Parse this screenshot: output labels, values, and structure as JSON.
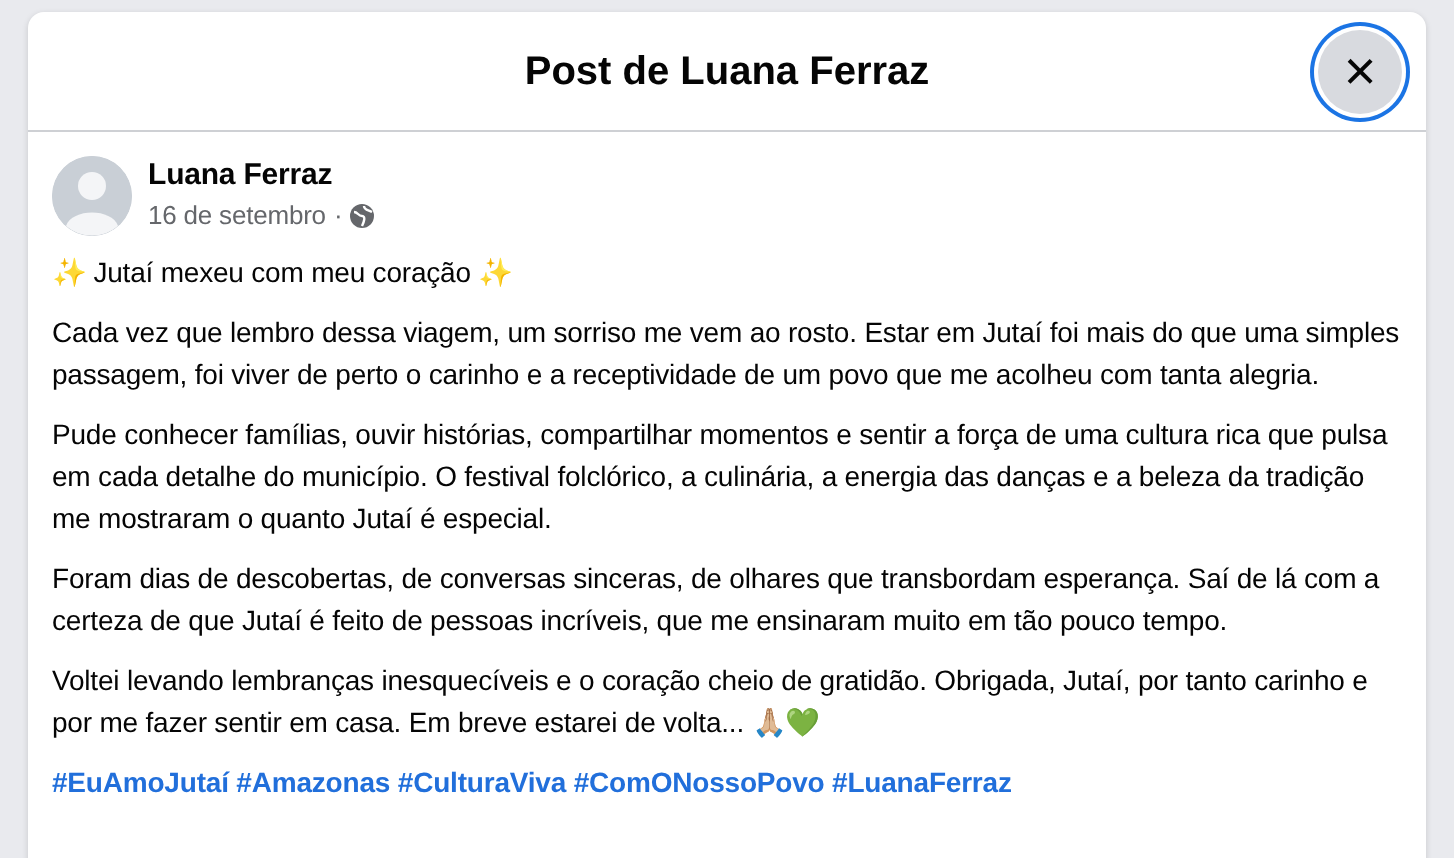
{
  "dialog": {
    "title": "Post de Luana Ferraz",
    "close": {
      "label": "×",
      "focused": true
    }
  },
  "post": {
    "author": "Luana Ferraz",
    "date": "16 de setembro",
    "separator": "·",
    "paragraphs": [
      "✨ Jutaí mexeu com meu coração ✨",
      "Cada vez que lembro dessa viagem, um sorriso me vem ao rosto. Estar em Jutaí foi mais do que uma simples passagem, foi viver de perto o carinho e a receptividade de um povo que me acolheu com tanta alegria.",
      "Pude conhecer famílias, ouvir histórias, compartilhar momentos e sentir a força de uma cultura rica que pulsa em cada detalhe do município. O festival folclórico, a culinária, a energia das danças e a beleza da tradição me mostraram o quanto Jutaí é especial.",
      "Foram dias de descobertas, de conversas sinceras, de olhares que transbordam esperança. Saí de lá com a certeza de que Jutaí é feito de pessoas incríveis, que me ensinaram muito em tão pouco tempo.",
      "Voltei levando lembranças inesquecíveis e o coração cheio de gratidão. Obrigada, Jutaí, por tanto carinho e por me fazer sentir em casa. Em breve estarei de volta... 🙏🏼💚"
    ],
    "hashtags": [
      "#EuAmoJutaí",
      "#Amazonas",
      "#CulturaViva",
      "#ComONossoPovo",
      "#LuanaFerraz"
    ]
  }
}
